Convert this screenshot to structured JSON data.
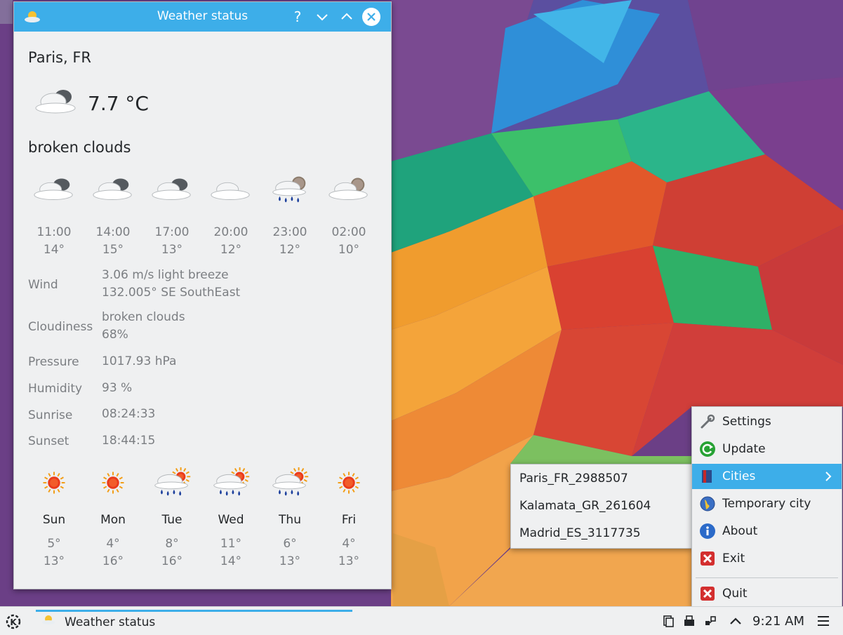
{
  "window": {
    "title": "Weather status"
  },
  "current": {
    "city": "Paris, FR",
    "temperature": "7.7 °C",
    "condition": "broken clouds",
    "icon": "broken-clouds-icon"
  },
  "hourly": [
    {
      "time": "11:00",
      "temp": "14°",
      "icon": "broken-clouds-icon"
    },
    {
      "time": "14:00",
      "temp": "15°",
      "icon": "broken-clouds-icon"
    },
    {
      "time": "17:00",
      "temp": "13°",
      "icon": "broken-clouds-icon"
    },
    {
      "time": "20:00",
      "temp": "12°",
      "icon": "cloud-icon"
    },
    {
      "time": "23:00",
      "temp": "12°",
      "icon": "rain-night-icon"
    },
    {
      "time": "02:00",
      "temp": "10°",
      "icon": "cloud-night-icon"
    }
  ],
  "details": {
    "wind_label": "Wind",
    "wind_value1": "3.06 m/s light breeze",
    "wind_value2": "132.005° SE SouthEast",
    "cloudiness_label": "Cloudiness",
    "cloudiness_value1": "broken clouds",
    "cloudiness_value2": "68%",
    "pressure_label": "Pressure",
    "pressure_value": "1017.93 hPa",
    "humidity_label": "Humidity",
    "humidity_value": "93 %",
    "sunrise_label": "Sunrise",
    "sunrise_value": "08:24:33",
    "sunset_label": "Sunset",
    "sunset_value": "18:44:15"
  },
  "daily": [
    {
      "day": "Sun",
      "min": "5°",
      "max": "13°",
      "icon": "sun-icon"
    },
    {
      "day": "Mon",
      "min": "4°",
      "max": "16°",
      "icon": "sun-icon"
    },
    {
      "day": "Tue",
      "min": "8°",
      "max": "16°",
      "icon": "rain-sun-icon"
    },
    {
      "day": "Wed",
      "min": "11°",
      "max": "14°",
      "icon": "rain-sun-icon"
    },
    {
      "day": "Thu",
      "min": "6°",
      "max": "13°",
      "icon": "rain-sun-icon"
    },
    {
      "day": "Fri",
      "min": "4°",
      "max": "13°",
      "icon": "sun-icon"
    }
  ],
  "menu": {
    "items": [
      {
        "label": "Settings",
        "icon": "wrench-icon"
      },
      {
        "label": "Update",
        "icon": "refresh-icon"
      },
      {
        "label": "Cities",
        "icon": "book-icon"
      },
      {
        "label": "Temporary city",
        "icon": "globe-icon"
      },
      {
        "label": "About",
        "icon": "info-icon"
      },
      {
        "label": "Exit",
        "icon": "close-red-icon"
      },
      {
        "label": "Quit",
        "icon": "close-red-icon"
      }
    ],
    "active_index": 2,
    "submenu": [
      "Paris_FR_2988507",
      "Kalamata_GR_261604",
      "Madrid_ES_3117735"
    ]
  },
  "taskbar": {
    "task_label": "Weather status",
    "clock": "9:21 AM"
  },
  "colors": {
    "accent": "#3daee9",
    "window_bg": "#eff0f1"
  }
}
